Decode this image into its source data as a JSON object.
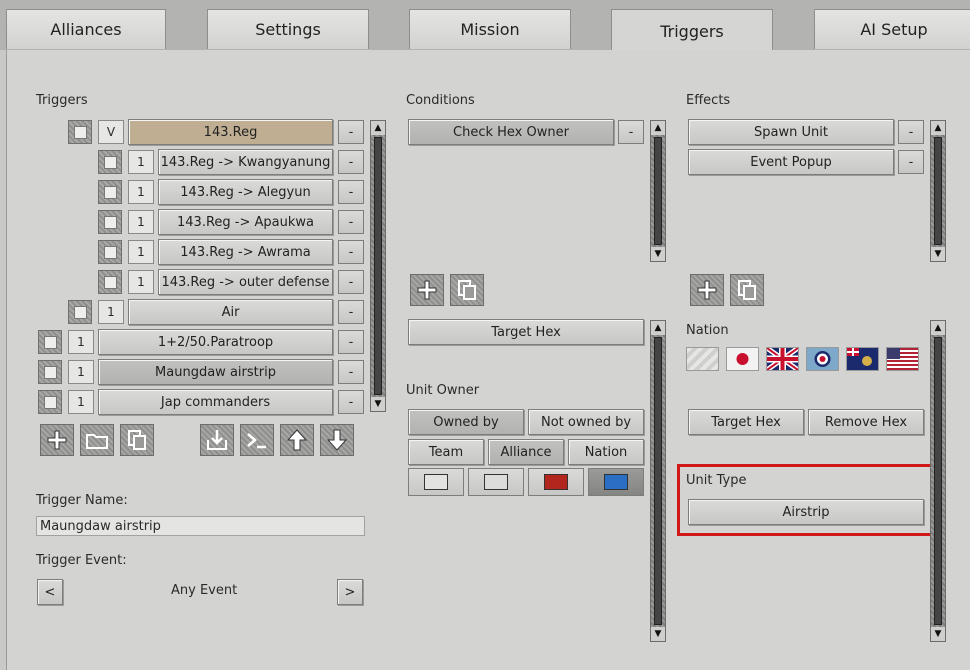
{
  "tabs": [
    {
      "label": "Alliances"
    },
    {
      "label": "Settings"
    },
    {
      "label": "Mission"
    },
    {
      "label": "Triggers",
      "active": true
    },
    {
      "label": "AI Setup"
    }
  ],
  "triggers": {
    "heading": "Triggers",
    "v_label": "V",
    "minus": "-",
    "items": [
      {
        "count": "",
        "label": "143.Reg"
      },
      {
        "count": "1",
        "label": "143.Reg -> Kwangyanung"
      },
      {
        "count": "1",
        "label": "143.Reg -> Alegyun"
      },
      {
        "count": "1",
        "label": "143.Reg -> Apaukwa"
      },
      {
        "count": "1",
        "label": "143.Reg -> Awrama"
      },
      {
        "count": "1",
        "label": "143.Reg -> outer defense"
      },
      {
        "count": "1",
        "label": "Air"
      },
      {
        "count": "1",
        "label": "1+2/50.Paratroop"
      },
      {
        "count": "1",
        "label": "Maungdaw airstrip"
      },
      {
        "count": "1",
        "label": "Jap commanders"
      }
    ],
    "name_label": "Trigger Name:",
    "name_value": "Maungdaw airstrip",
    "event_label": "Trigger Event:",
    "event_value": "Any Event",
    "prev": "<",
    "next": ">"
  },
  "conditions": {
    "heading": "Conditions",
    "items": [
      "Check Hex Owner"
    ],
    "target_hex": "Target Hex",
    "unit_owner_label": "Unit Owner",
    "owned_by": "Owned by",
    "not_owned_by": "Not owned by",
    "team": "Team",
    "alliance": "Alliance",
    "nation": "Nation",
    "swatch_colors": [
      "#e2e2e0",
      "#dcdcda",
      "#b3261e",
      "#2a6fc4"
    ]
  },
  "effects": {
    "heading": "Effects",
    "items": [
      "Spawn Unit",
      "Event Popup"
    ],
    "nation_label": "Nation",
    "target_hex": "Target Hex",
    "remove_hex": "Remove Hex",
    "unit_type_label": "Unit Type",
    "unit_type_value": "Airstrip"
  },
  "colors": {
    "highlight": "#d01818",
    "selected_trigger": "#bfae92"
  }
}
